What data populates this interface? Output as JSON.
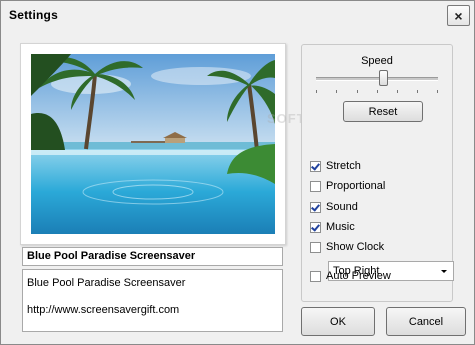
{
  "window": {
    "title": "Settings",
    "close_glyph": "×"
  },
  "preview": {
    "name": "Blue Pool Paradise Screensaver",
    "description_line1": "Blue Pool Paradise Screensaver",
    "description_line2": "http://www.screensavergift.com"
  },
  "options": {
    "speed_label": "Speed",
    "speed_level": 0.55,
    "reset_label": "Reset",
    "checkboxes": [
      {
        "label": "Stretch",
        "checked": true
      },
      {
        "label": "Proportional",
        "checked": false
      },
      {
        "label": "Sound",
        "checked": true
      },
      {
        "label": "Music",
        "checked": true
      },
      {
        "label": "Show Clock",
        "checked": false
      }
    ],
    "clock_position": "Top Right",
    "auto_preview": {
      "label": "Auto Preview",
      "checked": false
    }
  },
  "buttons": {
    "ok": "OK",
    "cancel": "Cancel"
  },
  "colors": {
    "accent_check": "#21429e",
    "sky": "#7fb6e2",
    "water": "#2bb5d8"
  }
}
